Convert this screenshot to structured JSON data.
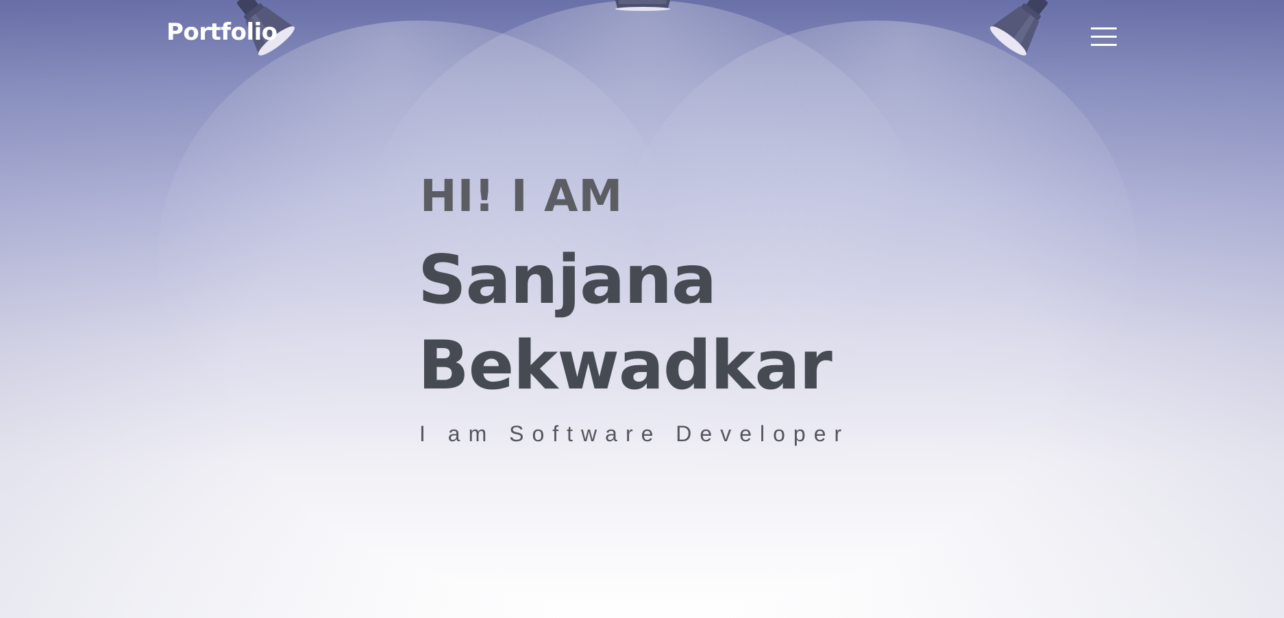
{
  "navbar": {
    "brand": "Portfolio",
    "menu_icon": "hamburger-menu-icon"
  },
  "hero": {
    "greeting": "HI! I AM",
    "first_name": "Sanjana",
    "last_name": "Bekwadkar",
    "tagline": "I am Software Developer",
    "decorations": [
      "spotlight-lamp-icon",
      "spotlight-lamp-icon",
      "spotlight-lamp-icon"
    ]
  },
  "colors": {
    "background_top": "#6b72aa",
    "background_bottom": "#ffffff",
    "greeting_text": "#5b5d63",
    "name_text": "#464a52",
    "tagline_text": "#54565c",
    "nav_text": "#ffffff"
  }
}
